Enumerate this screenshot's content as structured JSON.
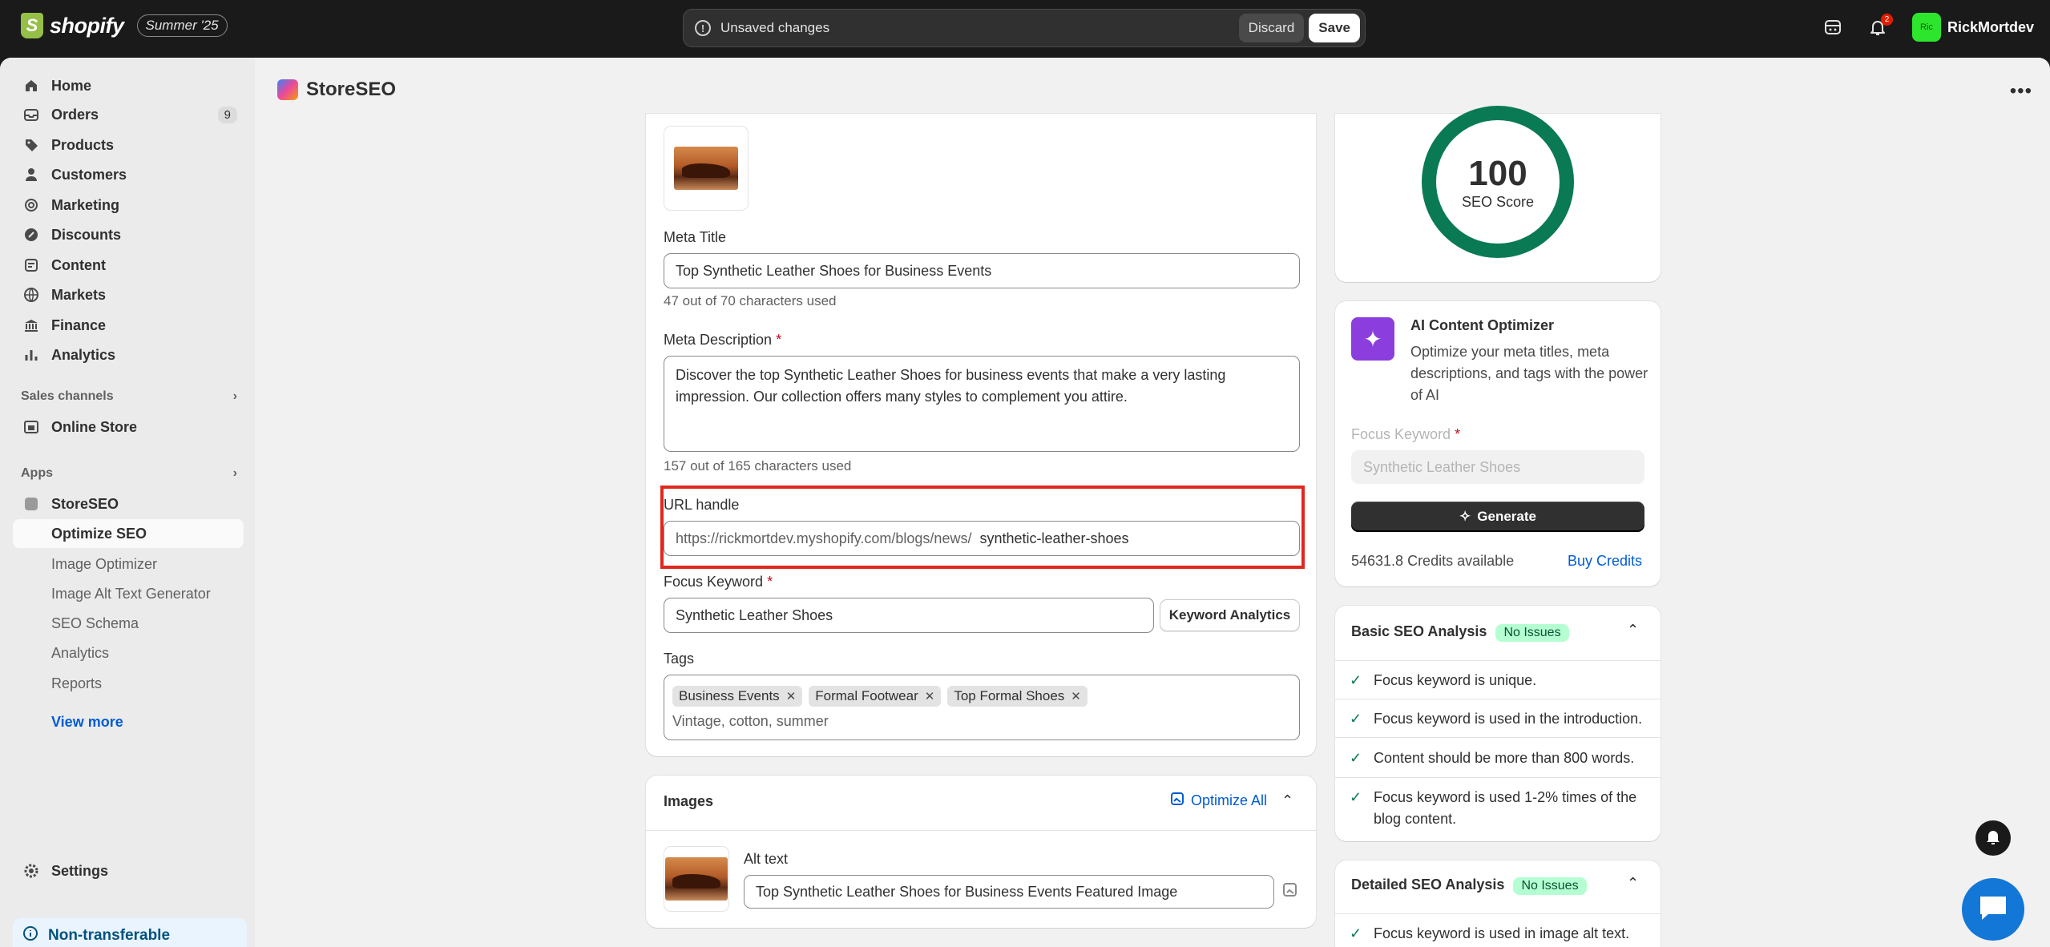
{
  "topbar": {
    "brand": "shopify",
    "edition": "Summer '25",
    "unsaved_message": "Unsaved changes",
    "discard_label": "Discard",
    "save_label": "Save",
    "notification_count": "2",
    "avatar_initials": "Ric",
    "username": "RickMortdev"
  },
  "sidebar": {
    "items": [
      {
        "label": "Home",
        "icon": "home-icon"
      },
      {
        "label": "Orders",
        "icon": "orders-icon",
        "count": "9"
      },
      {
        "label": "Products",
        "icon": "tag-icon"
      },
      {
        "label": "Customers",
        "icon": "person-icon"
      },
      {
        "label": "Marketing",
        "icon": "target-icon"
      },
      {
        "label": "Discounts",
        "icon": "discount-icon"
      },
      {
        "label": "Content",
        "icon": "content-icon"
      },
      {
        "label": "Markets",
        "icon": "globe-icon"
      },
      {
        "label": "Finance",
        "icon": "bank-icon"
      },
      {
        "label": "Analytics",
        "icon": "bar-chart-icon"
      }
    ],
    "sales_channels_label": "Sales channels",
    "online_store_label": "Online Store",
    "apps_label": "Apps",
    "app_name": "StoreSEO",
    "app_subitems": [
      "Optimize SEO",
      "Image Optimizer",
      "Image Alt Text Generator",
      "SEO Schema",
      "Analytics",
      "Reports"
    ],
    "view_more": "View more",
    "settings_label": "Settings",
    "non_transferable": "Non-transferable"
  },
  "page": {
    "title": "StoreSEO"
  },
  "form": {
    "meta_title_label": "Meta Title",
    "meta_title_value": "Top Synthetic Leather Shoes for Business Events",
    "meta_title_help": "47 out of 70 characters used",
    "meta_description_label": "Meta Description",
    "required_mark": "*",
    "meta_description_value": "Discover the top Synthetic Leather Shoes for business events that make a very lasting impression. Our collection offers many styles to complement you attire.",
    "meta_description_help": "157 out of 165 characters used",
    "url_handle_label": "URL handle",
    "url_prefix": "https://rickmortdev.myshopify.com/blogs/news/",
    "url_handle_value": "synthetic-leather-shoes",
    "focus_keyword_label": "Focus Keyword",
    "focus_keyword_value": "Synthetic Leather Shoes",
    "keyword_analytics_label": "Keyword Analytics",
    "tags_label": "Tags",
    "tags": [
      "Business Events",
      "Formal Footwear",
      "Top Formal Shoes"
    ],
    "tags_placeholder": "Vintage, cotton, summer"
  },
  "images_card": {
    "title": "Images",
    "optimize_all": "Optimize All",
    "alt_text_label": "Alt text",
    "alt_text_value": "Top Synthetic Leather Shoes for Business Events Featured Image"
  },
  "score": {
    "value": "100",
    "label": "SEO Score",
    "ring_fraction": 1.0,
    "ring_color": "#0a7a55"
  },
  "ai_optimizer": {
    "title": "AI Content Optimizer",
    "description": "Optimize your meta titles, meta descriptions, and tags with the power of AI",
    "focus_keyword_label": "Focus Keyword",
    "focus_keyword_placeholder": "Synthetic Leather Shoes",
    "generate_label": "Generate",
    "credits": "54631.8 Credits available",
    "buy_credits": "Buy Credits"
  },
  "basic_analysis": {
    "title": "Basic SEO Analysis",
    "badge": "No Issues",
    "checks": [
      "Focus keyword is unique.",
      "Focus keyword is used in the introduction.",
      "Content should be more than 800 words.",
      "Focus keyword is used 1-2% times of the blog content."
    ]
  },
  "detailed_analysis": {
    "title": "Detailed SEO Analysis",
    "badge": "No Issues",
    "checks": [
      "Focus keyword is used in image alt text."
    ]
  }
}
